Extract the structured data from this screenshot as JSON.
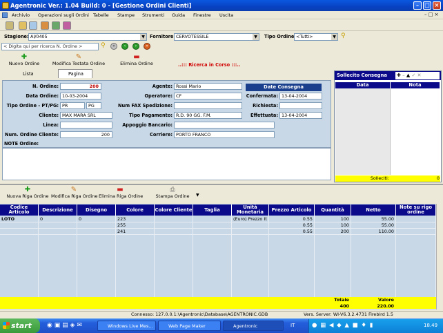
{
  "window": {
    "title": "Agentronic Ver.: 1.04 Build: 0 - [Gestione Ordini Clienti]"
  },
  "menu": [
    "Archivio",
    "Operazioni sugli Ordini",
    "Tabelle",
    "Stampe",
    "Strumenti",
    "Guida",
    "Finestre",
    "Uscita"
  ],
  "filters": {
    "stagione_label": "Stagione:",
    "stagione_value": "AI/0405",
    "fornitore_label": "Fornitore:",
    "fornitore_value": "CERVOTESSILE",
    "tipo_label": "Tipo Ordine",
    "tipo_value": "<Tutti>",
    "search_placeholder": "< Digita qui per ricerca N. Ordine >"
  },
  "actions": {
    "nuovo": "Nuovo Ordine",
    "modifica": "Modifica Testata Ordine",
    "elimina": "Elimina Ordine",
    "ricerca": "..::: Ricerca in Corso :::.."
  },
  "tabs": {
    "lista": "Lista",
    "pagina": "Pagina"
  },
  "form": {
    "n_ordine_label": "N. Ordine:",
    "n_ordine": "200",
    "data_ordine_label": "Data Ordine:",
    "data_ordine": "10-03-2004",
    "tipo_ordine_label": "Tipo Ordine - PT/PG:",
    "pt": "PR",
    "pg": "PG",
    "cliente_label": "Cliente:",
    "cliente": "MAX MARA SRL",
    "linea_label": "Linea:",
    "linea": "",
    "num_ordine_cliente_label": "Num. Ordine Cliente:",
    "num_ordine_cliente": "200",
    "note_label": "NOTE Ordine:",
    "agente_label": "Agente:",
    "agente": "Rossi Mario",
    "operatore_label": "Operatore:",
    "operatore": "CF",
    "fax_label": "Num FAX Spedizione:",
    "fax": "",
    "pagamento_label": "Tipo Pagamento:",
    "pagamento": "R.D. 90 GG. F.M.",
    "appoggio_label": "Appoggio Bancario:",
    "appoggio": "",
    "corriere_label": "Corriere:",
    "corriere": "PORTO FRANCO",
    "date_title": "Date Consegna",
    "conferma_label": "Confermata:",
    "conferma": "13-04-2004",
    "richiesta_label": "Richiesta:",
    "richiesta": "",
    "effettuata_label": "Effettuata:",
    "effettuata": "13-04-2004"
  },
  "sollecito": {
    "title": "Sollecito Consegna",
    "col_data": "Data",
    "col_nota": "Nota",
    "footer_label": "Solleciti:",
    "footer_value": "0"
  },
  "row_actions": {
    "nuova": "Nuova Riga Ordine",
    "modifica": "Modifica Riga Ordine",
    "elimina": "Elimina Riga Ordine",
    "stampa": "Stampa Ordine"
  },
  "grid": {
    "headers": [
      "Codice Articolo",
      "Descrizione",
      "Disegno",
      "Colore",
      "Colore Cliente",
      "Taglia",
      "Unità Monetaria",
      "Prezzo Articolo",
      "Quantità",
      "Netto",
      "Note su rigo ordine"
    ],
    "rows": [
      [
        "LOTO",
        "0",
        "0",
        "223",
        "",
        "",
        "(Euro) Prezzo Itali",
        "0.55",
        "100",
        "55.00",
        ""
      ],
      [
        "",
        "",
        "",
        "255",
        "",
        "",
        "",
        "0.55",
        "100",
        "55.00",
        ""
      ],
      [
        "",
        "",
        "",
        "241",
        "",
        "",
        "",
        "0.55",
        "200",
        "110.00",
        ""
      ]
    ],
    "totale_label": "Totale",
    "totale": "400",
    "valore_label": "Valore",
    "valore": "220.00"
  },
  "status": {
    "connessione": "Connesso: 127.0.0.1:\\Agentronic\\Database\\AGENTRONIC.GDB",
    "server": "Vers. Server: WI-V6.3.2.4731 Firebird 1.5"
  },
  "taskbar": {
    "start": "start",
    "tasks": [
      "Windows Live Mes...",
      "Web Page Maker",
      "Agentronic"
    ],
    "lang": "IT",
    "clock": "18.49"
  },
  "colors": {
    "title_blue": "#0842c2",
    "form_bg": "#c8d8e6",
    "grid_header": "#0a0a8a",
    "total_yellow": "#ffff00",
    "red_value": "#c00000"
  }
}
